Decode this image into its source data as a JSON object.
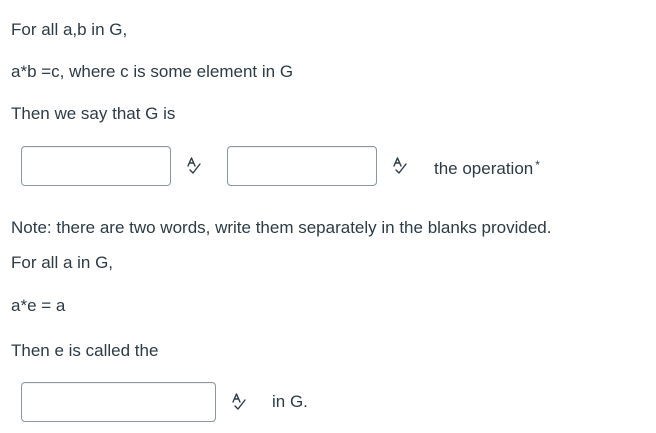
{
  "question_1": {
    "line_1": "For all a,b in G,",
    "line_2": "a*b =c, where c is some element in G",
    "line_3": "Then we say that G is",
    "blank_1_value": "",
    "blank_2_value": "",
    "after_blanks_text": "the operation",
    "required_marker": "*",
    "note": "Note: there are two words, write them separately in the blanks provided."
  },
  "question_2": {
    "line_1": "For all a in G,",
    "line_2": "a*e = a",
    "line_3": "Then e is called the",
    "blank_value": "",
    "after_blank_text": "in G."
  },
  "icons": {
    "spellcheck": "spellcheck-icon"
  }
}
